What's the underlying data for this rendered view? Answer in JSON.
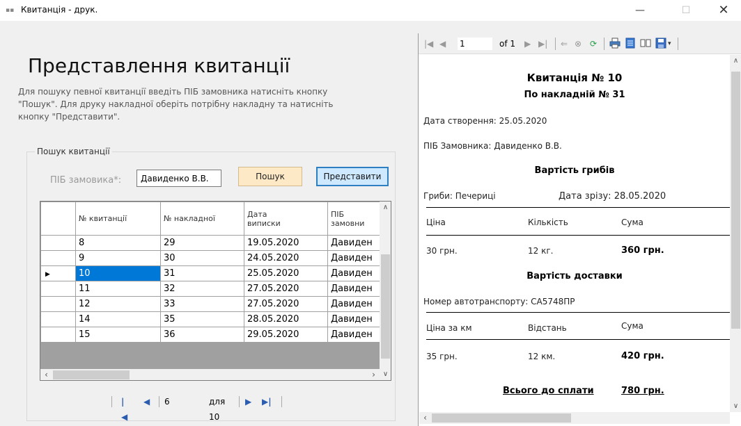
{
  "window": {
    "title": "Квитанція - друк.",
    "min_glyph": "—",
    "max_glyph": "☐",
    "close_glyph": "✕"
  },
  "form": {
    "heading": "Представлення квитанції",
    "description": "Для пошуку певної квитанції введіть ПІБ замовника натисніть кнопку \"Пошук\". Для друку накладної оберіть потрібну накладну та натисніть кнопку \"Представити\".",
    "group_title": "Пошук квитанції",
    "pib_label": "ПІБ замовика*:",
    "pib_value": "Давиденко В.В.",
    "search_button": "Пошук",
    "present_button": "Представити"
  },
  "grid": {
    "columns": [
      "№ квитанції",
      "№ накладної",
      "Дата\nвиписки",
      "ПІБ\nзамовни"
    ],
    "rows": [
      [
        "8",
        "29",
        "19.05.2020",
        "Давиден"
      ],
      [
        "9",
        "30",
        "24.05.2020",
        "Давиден"
      ],
      [
        "10",
        "31",
        "25.05.2020",
        "Давиден"
      ],
      [
        "11",
        "32",
        "27.05.2020",
        "Давиден"
      ],
      [
        "12",
        "33",
        "27.05.2020",
        "Давиден"
      ],
      [
        "14",
        "35",
        "28.05.2020",
        "Давиден"
      ],
      [
        "15",
        "36",
        "29.05.2020",
        "Давиден"
      ]
    ],
    "selected_row": 2
  },
  "navigator": {
    "position": "6",
    "count": "для 10"
  },
  "viewer": {
    "page": "1",
    "of": "of 1"
  },
  "report": {
    "title": "Квитанція № 10",
    "subtitle": "По накладній № 31",
    "created": "Дата створення: 25.05.2020",
    "customer": "ПІБ Замовника: Давиденко В.В.",
    "mushroom_section": "Вартість грибів",
    "mushroom_type": "Гриби: Печериці",
    "cut_date": "Дата зрізу: 28.05.2020",
    "price_label": "Ціна",
    "qty_label": "Кількість",
    "sum_label": "Сума",
    "price_value": "30 грн.",
    "qty_value": "12 кг.",
    "sum_value": "360 грн.",
    "delivery_section": "Вартість доставки",
    "vehicle": "Номер автотранспорту:  СА5748ПР",
    "per_km_label": "Ціна за км",
    "distance_label": "Відстань",
    "delivery_sum_label": "Сума",
    "per_km_value": "35 грн.",
    "distance_value": "12 км.",
    "delivery_sum_value": "420 грн.",
    "total_label": "Всього до сплати",
    "total_value": "780 грн."
  }
}
